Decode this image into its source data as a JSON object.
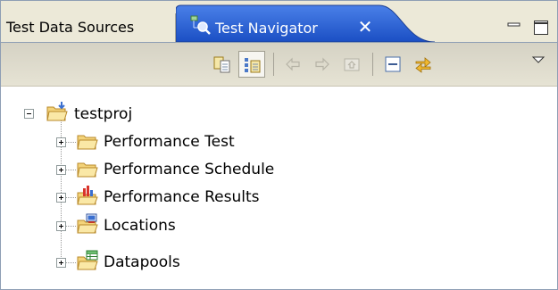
{
  "tabs": [
    {
      "label": "Test Data Sources",
      "active": false
    },
    {
      "label": "Test Navigator",
      "active": true,
      "icon": "navigator-icon",
      "close": "✕"
    }
  ],
  "view_controls": [
    "minimize-icon",
    "maximize-icon"
  ],
  "toolbar": [
    {
      "name": "show-resources-icon",
      "pressed": false
    },
    {
      "name": "show-logical-icon",
      "pressed": true
    },
    {
      "name": "back-arrow-icon",
      "enabled": false
    },
    {
      "name": "forward-arrow-icon",
      "enabled": false
    },
    {
      "name": "home-icon",
      "enabled": false
    },
    {
      "name": "collapse-all-icon",
      "enabled": true
    },
    {
      "name": "link-with-editor-icon",
      "enabled": true
    },
    {
      "name": "view-menu-icon",
      "enabled": true
    }
  ],
  "tree": {
    "root": {
      "label": "testproj",
      "expanded": true,
      "icon": "project-folder-icon"
    },
    "children": [
      {
        "label": "Performance Test",
        "icon": "folder-icon"
      },
      {
        "label": "Performance Schedule",
        "icon": "folder-icon"
      },
      {
        "label": "Performance Results",
        "icon": "results-folder-icon"
      },
      {
        "label": "Locations",
        "icon": "locations-folder-icon"
      },
      {
        "label": "Datapools",
        "icon": "datapools-folder-icon"
      }
    ]
  },
  "colors": {
    "tab_active": "#245edb",
    "chrome": "#ece9d8",
    "border": "#8e9eb4",
    "folder": "#f3d37a"
  }
}
